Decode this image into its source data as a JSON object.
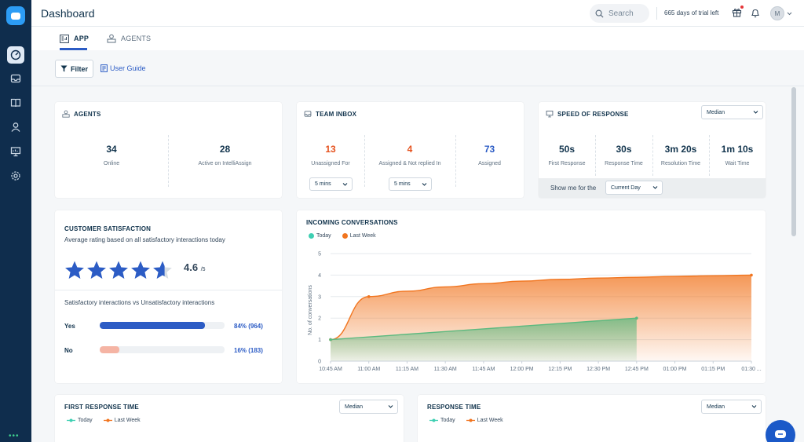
{
  "header": {
    "title": "Dashboard",
    "search_placeholder": "Search",
    "trial_text": "665 days of trial left",
    "avatar_initial": "M"
  },
  "tabs": [
    {
      "label": "APP",
      "active": true
    },
    {
      "label": "AGENTS",
      "active": false
    }
  ],
  "filterbar": {
    "filter_label": "Filter",
    "guide_label": "User Guide"
  },
  "agents": {
    "title": "AGENTS",
    "stats": [
      {
        "value": "34",
        "label": "Online"
      },
      {
        "value": "28",
        "label": "Active on IntelliAssign"
      }
    ]
  },
  "team_inbox": {
    "title": "TEAM INBOX",
    "stats": [
      {
        "value": "13",
        "label": "Unassigned For",
        "color": "#e5511d"
      },
      {
        "value": "4",
        "label": "Assigned & Not replied In",
        "color": "#e5511d"
      },
      {
        "value": "73",
        "label": "Assigned",
        "color": "#2c5cc5"
      }
    ],
    "selects": [
      "5 mins",
      "5 mins"
    ]
  },
  "speed": {
    "title": "SPEED OF RESPONSE",
    "select": "Median",
    "stats": [
      {
        "value": "50s",
        "label": "First Response"
      },
      {
        "value": "30s",
        "label": "Response Time"
      },
      {
        "value": "3m 20s",
        "label": "Resolution Time"
      },
      {
        "value": "1m 10s",
        "label": "Wait Time"
      }
    ],
    "show_label": "Show me for the",
    "period": "Current Day"
  },
  "satisfaction": {
    "title": "CUSTOMER SATISFACTION",
    "subtitle": "Average rating based on all satisfactory interactions today",
    "rating": "4.6",
    "rating_suffix": "/5",
    "rating_value": 4.6,
    "compare_label": "Satisfactory interactions vs Unsatisfactory interactions",
    "rows": [
      {
        "label": "Yes",
        "percent": 84,
        "value": "84% (964)",
        "color": "#2c5cc5"
      },
      {
        "label": "No",
        "percent": 16,
        "value": "16% (183)",
        "color": "#f5b4a4"
      }
    ]
  },
  "colors": {
    "today": "#3ecfb2",
    "last_week": "#f1751f",
    "accent": "#2c5cc5",
    "sidebar": "#0f2d4d"
  },
  "chart_data": {
    "type": "area",
    "title": "INCOMING CONVERSATIONS",
    "ylabel": "No. of conversations",
    "xlabel": "",
    "ylim": [
      0,
      5
    ],
    "yticks": [
      "0",
      "1",
      "2",
      "3",
      "4",
      "5"
    ],
    "x": [
      "10:45 AM",
      "11:00 AM",
      "11:15 AM",
      "11:30 AM",
      "11:45 AM",
      "12:00 PM",
      "12:15 PM",
      "12:30 PM",
      "12:45 PM",
      "01:00 PM",
      "01:15 PM",
      "01:30 ..."
    ],
    "series": [
      {
        "name": "Today",
        "color": "#5cb97f",
        "values": [
          1,
          1.125,
          1.25,
          1.375,
          1.5,
          1.625,
          1.75,
          1.875,
          2,
          null,
          null,
          null
        ]
      },
      {
        "name": "Last Week",
        "color": "#f1751f",
        "values": [
          1,
          3,
          3.25,
          3.45,
          3.6,
          3.72,
          3.8,
          3.86,
          3.9,
          3.94,
          3.97,
          4
        ]
      }
    ],
    "legend": "top-left",
    "grid": true
  },
  "first_response": {
    "title": "FIRST RESPONSE TIME",
    "select": "Median",
    "legend": [
      "Today",
      "Last Week"
    ]
  },
  "response_time": {
    "title": "RESPONSE TIME",
    "select": "Median",
    "legend": [
      "Today",
      "Last Week"
    ]
  },
  "icons": [
    "dashboard-icon",
    "inbox-icon",
    "book-icon",
    "user-icon",
    "presentation-icon",
    "gear-icon",
    "search-icon",
    "gift-icon",
    "bell-icon",
    "filter-icon",
    "guide-icon",
    "star-icon",
    "chat-icon"
  ]
}
